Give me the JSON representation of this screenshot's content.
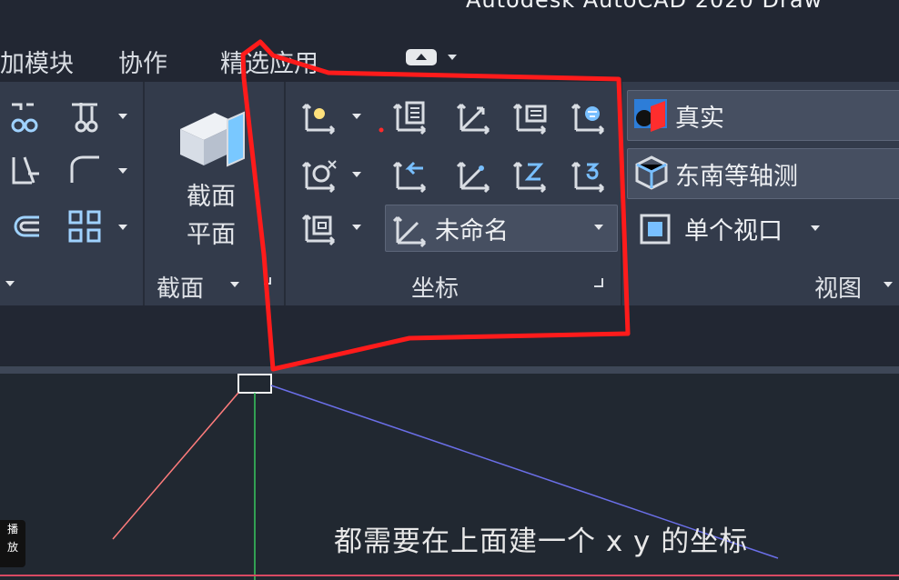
{
  "window": {
    "title": "Autodesk AutoCAD 2020    Draw"
  },
  "tabs": [
    {
      "label": "加模块"
    },
    {
      "label": "协作"
    },
    {
      "label": "精选应用"
    }
  ],
  "ribbon": {
    "section_panel": {
      "label": "截面",
      "button_label_1": "截面",
      "button_label_2": "平面"
    },
    "coordinates_panel": {
      "label": "坐标",
      "ucs_combo_value": "未命名"
    },
    "view_panel": {
      "label": "视图",
      "visual_style_value": "真实",
      "view_direction_value": "东南等轴测",
      "viewport_value": "单个视口"
    }
  },
  "subtitle": "都需要在上面建一个 x y 的坐标",
  "side_badge": {
    "line1": "播",
    "line2": "放"
  },
  "colors": {
    "ribbon": "#333b4b",
    "highlight_red": "#ff1b1b",
    "axis_green": "#39c85f",
    "axis_blue": "#6b6fe8",
    "axis_red": "#ff7c7c"
  }
}
